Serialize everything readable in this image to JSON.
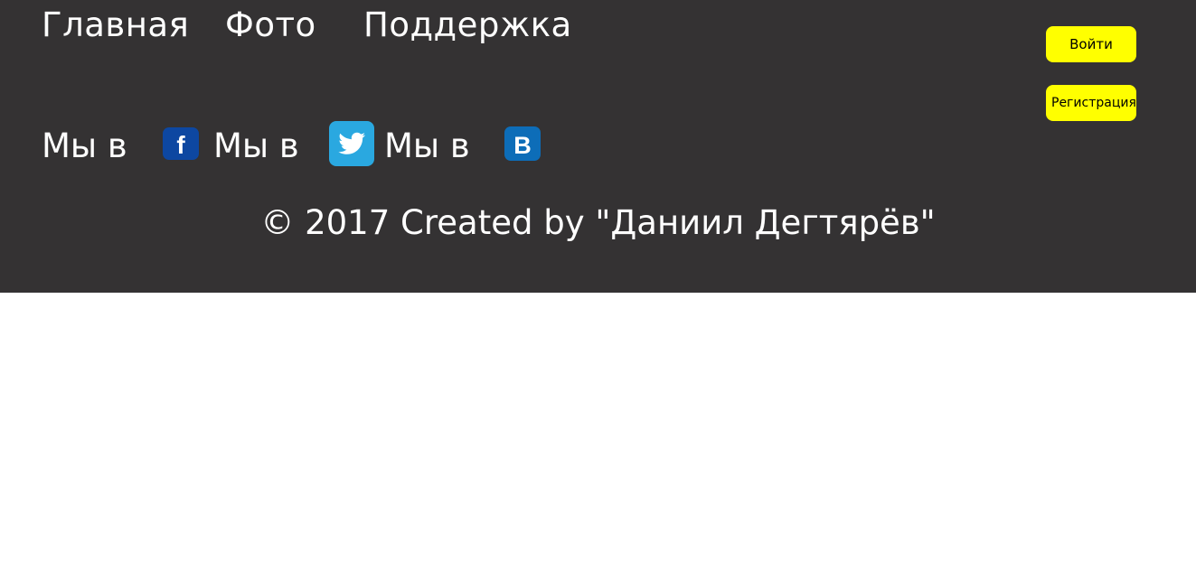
{
  "nav": {
    "items": [
      {
        "label": "Главная"
      },
      {
        "label": "Фото"
      },
      {
        "label": "Поддержка"
      }
    ]
  },
  "auth": {
    "login_label": "Войти",
    "register_label": "Регистрация"
  },
  "social": {
    "prefix": "Мы в",
    "items": [
      {
        "icon": "facebook-icon",
        "color": "#0d47a1"
      },
      {
        "icon": "twitter-icon",
        "color": "#2aa8e0"
      },
      {
        "icon": "vk-icon",
        "color": "#0d6db8"
      }
    ]
  },
  "footer": {
    "copyright": "© 2017 Created by \"Даниил Дегтярёв\""
  },
  "colors": {
    "panel_bg": "#343233",
    "button_bg": "#ffff00",
    "text": "#ffffff"
  }
}
